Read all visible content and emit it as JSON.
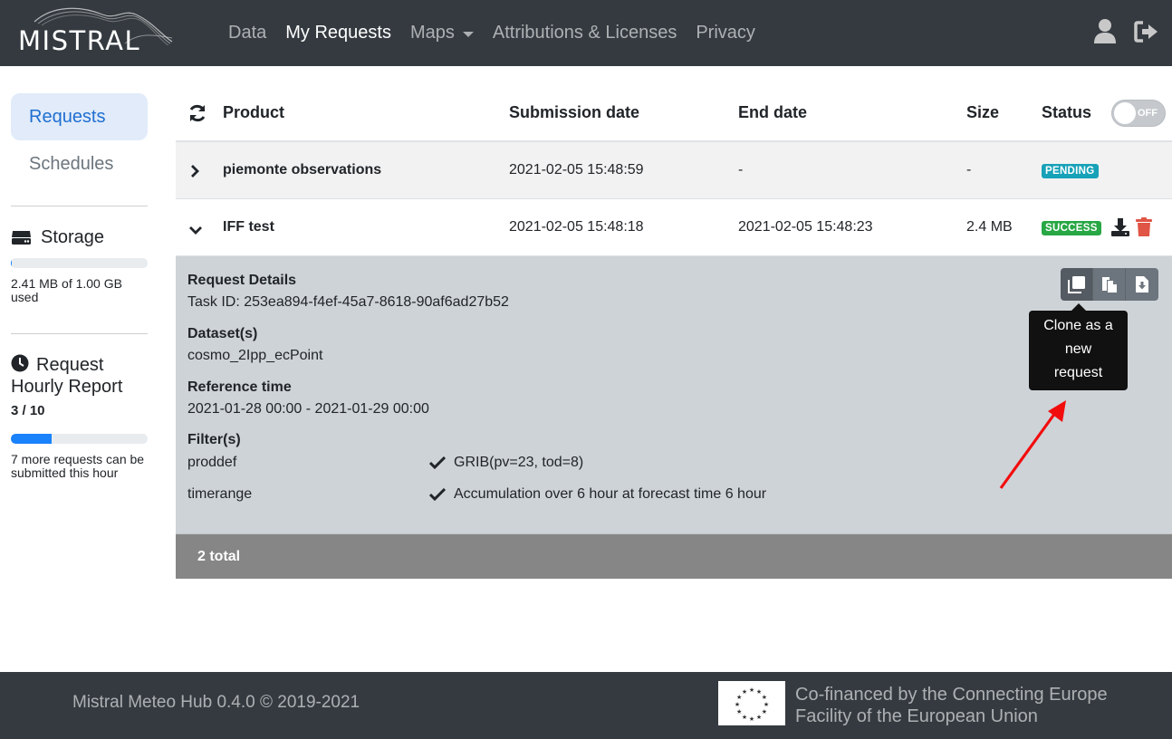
{
  "navbar": {
    "logo_text": "MISTRAL",
    "links": [
      {
        "label": "Data",
        "active": false
      },
      {
        "label": "My Requests",
        "active": true
      },
      {
        "label": "Maps",
        "active": false,
        "dropdown": true
      },
      {
        "label": "Attributions & Licenses",
        "active": false
      },
      {
        "label": "Privacy",
        "active": false
      }
    ],
    "icons": [
      "user-icon",
      "logout-icon"
    ]
  },
  "sidebar": {
    "items": [
      {
        "label": "Requests",
        "active": true
      },
      {
        "label": "Schedules",
        "active": false
      }
    ],
    "storage": {
      "title": "Storage",
      "usage_text": "2.41 MB of 1.00 GB used",
      "fraction": 0.0024
    },
    "report": {
      "title": "Request Hourly Report",
      "count": "3 / 10",
      "fraction": 0.3,
      "note": "7 more requests can be submitted this hour"
    }
  },
  "table": {
    "headers": {
      "product": "Product",
      "submission": "Submission date",
      "end": "End date",
      "size": "Size",
      "status": "Status"
    },
    "toggle_label": "OFF",
    "rows": [
      {
        "product": "piemonte observations",
        "submission": "2021-02-05 15:48:59",
        "end": "-",
        "size": "-",
        "status": "PENDING"
      },
      {
        "product": "IFF test",
        "submission": "2021-02-05 15:48:18",
        "end": "2021-02-05 15:48:23",
        "size": "2.4 MB",
        "status": "SUCCESS"
      }
    ],
    "details": {
      "title": "Request Details",
      "task_id": "Task ID: 253ea894-f4ef-45a7-8618-90af6ad27b52",
      "datasets_label": "Dataset(s)",
      "datasets_value": "cosmo_2Ipp_ecPoint",
      "reftime_label": "Reference time",
      "reftime_value": "2021-01-28 00:00 - 2021-01-29 00:00",
      "filters_label": "Filter(s)",
      "filters": [
        {
          "name": "proddef",
          "value": "GRIB(pv=23, tod=8)"
        },
        {
          "name": "timerange",
          "value": "Accumulation over 6 hour at forecast time 6 hour"
        }
      ],
      "tooltip": "Clone as a new request",
      "tooltip_lines": [
        "Clone as a",
        "new",
        "request"
      ]
    },
    "total": "2 total"
  },
  "footer": {
    "copyright": "Mistral Meteo Hub 0.4.0 © 2019-2021",
    "cofinanced_line1": "Co-financed by the Connecting Europe",
    "cofinanced_line2": "Facility of the European Union"
  },
  "colors": {
    "navbar": "#343a40",
    "accent": "#1f6fd1",
    "pending": "#17a2b8",
    "success": "#28a745",
    "danger": "#e05545"
  }
}
